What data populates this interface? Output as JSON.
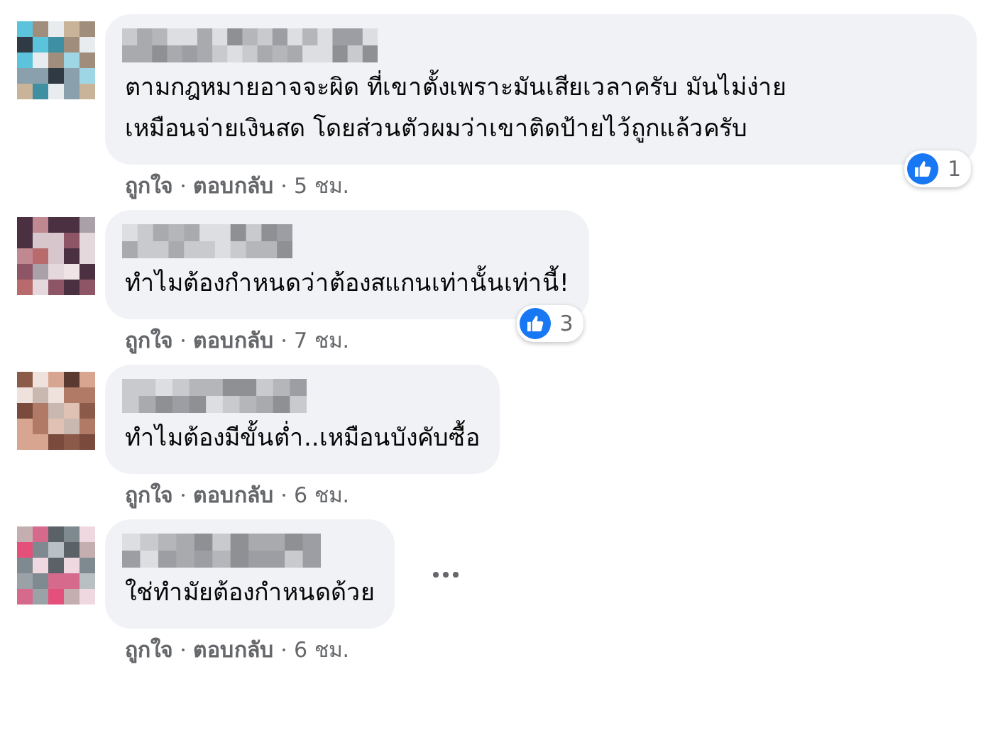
{
  "comments": [
    {
      "text": "ตามกฎหมายอาจจะผิด ที่เขาตั้งเพราะมันเสียเวลาครับ มันไม่ง่ายเหมือนจ่ายเงินสด โดยส่วนตัวผมว่าเขาติดป้ายไว้ถูกแล้วครับ",
      "reactions": "1",
      "actions": [
        "ถูกใจ",
        "ตอบกลับ",
        "5 ชม."
      ]
    },
    {
      "text": "ทำไมต้องกำหนดว่าต้องสแกนเท่านั้นเท่านี้!",
      "reactions": "3",
      "actions": [
        "ถูกใจ",
        "ตอบกลับ",
        "7 ชม."
      ]
    },
    {
      "text": "ทำไมต้องมีขั้นต่ำ..เหมือนบังคับซื้อ",
      "actions": [
        "ถูกใจ",
        "ตอบกลับ",
        "6 ชม."
      ]
    },
    {
      "text": "ใช่ทำมัยต้องกำหนดด้วย",
      "more": true,
      "actions": [
        "ถูกใจ",
        "ตอบกลับ",
        "6 ชม."
      ]
    }
  ]
}
